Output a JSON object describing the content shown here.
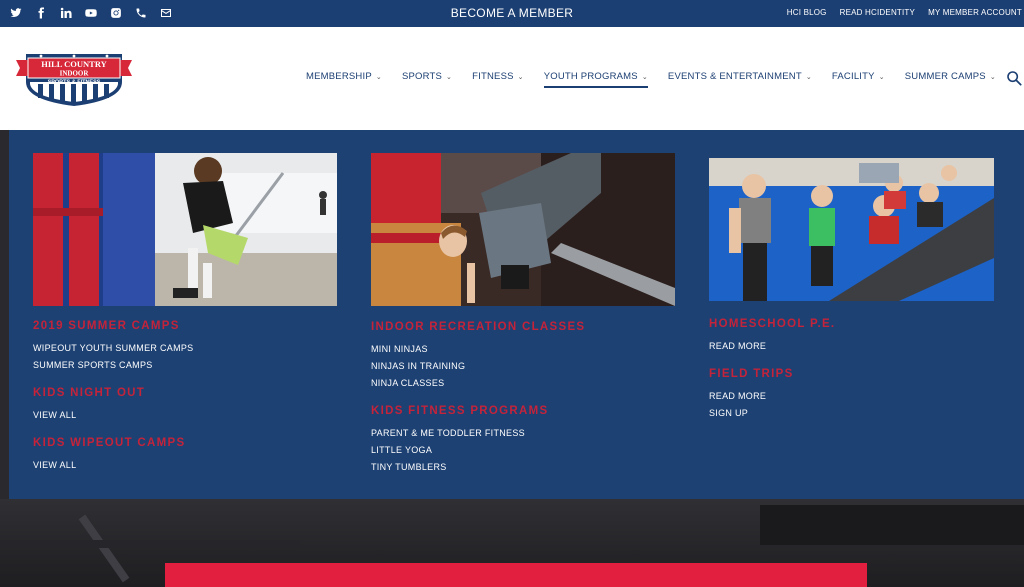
{
  "topbar": {
    "social_icons": [
      "twitter-icon",
      "facebook-icon",
      "linkedin-icon",
      "youtube-icon",
      "instagram-icon",
      "phone-icon",
      "mail-icon"
    ],
    "become_member": "BECOME A MEMBER",
    "links": [
      "HCI BLOG",
      "READ HCIDENTITY",
      "MY MEMBER ACCOUNT"
    ]
  },
  "logo": {
    "line1": "HILL COUNTRY",
    "line2": "INDOOR",
    "line3": "SPORTS & FITNESS"
  },
  "nav": {
    "items": [
      {
        "label": "MEMBERSHIP"
      },
      {
        "label": "SPORTS"
      },
      {
        "label": "FITNESS"
      },
      {
        "label": "YOUTH PROGRAMS"
      },
      {
        "label": "EVENTS & ENTERTAINMENT"
      },
      {
        "label": "FACILITY"
      },
      {
        "label": "SUMMER CAMPS"
      }
    ],
    "active": "YOUTH PROGRAMS"
  },
  "menu": {
    "col1": {
      "groups": [
        {
          "heading": "2019 SUMMER CAMPS",
          "links": [
            "WIPEOUT YOUTH SUMMER CAMPS",
            "SUMMER SPORTS CAMPS"
          ]
        },
        {
          "heading": "KIDS NIGHT OUT",
          "links": [
            "VIEW ALL"
          ]
        },
        {
          "heading": "KIDS WIPEOUT CAMPS",
          "links": [
            "VIEW ALL"
          ]
        }
      ]
    },
    "col2": {
      "groups": [
        {
          "heading": "INDOOR RECREATION CLASSES",
          "links": [
            "MINI NINJAS",
            "NINJAS IN TRAINING",
            "NINJA CLASSES"
          ]
        },
        {
          "heading": "KIDS FITNESS PROGRAMS",
          "links": [
            "PARENT & ME TODDLER FITNESS",
            "LITTLE YOGA",
            "TINY TUMBLERS"
          ]
        }
      ]
    },
    "col3": {
      "groups": [
        {
          "heading": "HOMESCHOOL P.E.",
          "links": [
            "READ MORE"
          ]
        },
        {
          "heading": "FIELD TRIPS",
          "links": [
            "READ MORE",
            "SIGN UP"
          ]
        }
      ]
    }
  },
  "colors": {
    "navy": "#1c3f73",
    "panel": "#1d4173",
    "accent_red": "#c4233a",
    "cta_red": "#e21f3f"
  }
}
